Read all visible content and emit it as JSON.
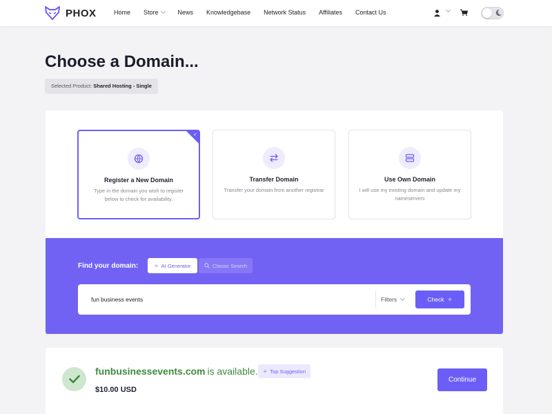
{
  "header": {
    "logo_text": "PHOX",
    "nav": [
      "Home",
      "Store",
      "News",
      "Knowledgebase",
      "Network Status",
      "Affiliates",
      "Contact Us"
    ]
  },
  "page": {
    "title": "Choose a Domain...",
    "selected_product_label": "Selected Product:",
    "selected_product_value": "Shared Hosting - Single"
  },
  "options": [
    {
      "title": "Register a New Domain",
      "desc": "Type in the domain you wish to register below to check for availability.",
      "icon": "globe-icon",
      "selected": true
    },
    {
      "title": "Transfer Domain",
      "desc": "Transfer your domain from another registrar",
      "icon": "transfer-icon",
      "selected": false
    },
    {
      "title": "Use Own Domain",
      "desc": "I will use my existing domain and update my nameservers",
      "icon": "server-icon",
      "selected": false
    }
  ],
  "search": {
    "label": "Find your domain:",
    "tab_ai": "AI Generator",
    "tab_classic": "Classic Search",
    "value": "fun business events",
    "filters_label": "Filters",
    "check_label": "Check"
  },
  "result": {
    "domain": "funbusinessevents.com",
    "status": "is available.",
    "badge": "Top Suggestion",
    "price": "$10.00 USD",
    "continue_label": "Continue"
  },
  "colors": {
    "accent": "#6b5ef7",
    "band": "#7262f4",
    "available": "#3d8a3d"
  }
}
